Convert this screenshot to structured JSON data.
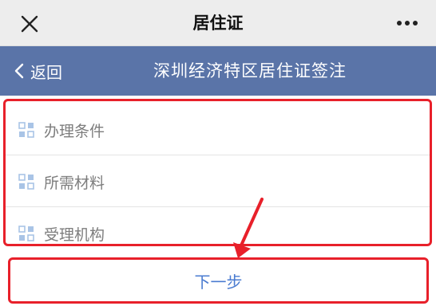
{
  "window": {
    "title": "居住证",
    "close_icon": "close-icon",
    "more_icon": "more-dots-icon"
  },
  "nav": {
    "back_label": "返回",
    "title": "深圳经济特区居住证签注"
  },
  "menu": {
    "items": [
      {
        "label": "办理条件",
        "icon": "grid-icon"
      },
      {
        "label": "所需材料",
        "icon": "grid-icon"
      },
      {
        "label": "受理机构",
        "icon": "grid-icon"
      }
    ]
  },
  "actions": {
    "next_label": "下一步"
  },
  "colors": {
    "nav_bg": "#5a74a8",
    "highlight": "#e8202a",
    "link": "#4a7bd0",
    "icon": "#a9c4e6"
  }
}
